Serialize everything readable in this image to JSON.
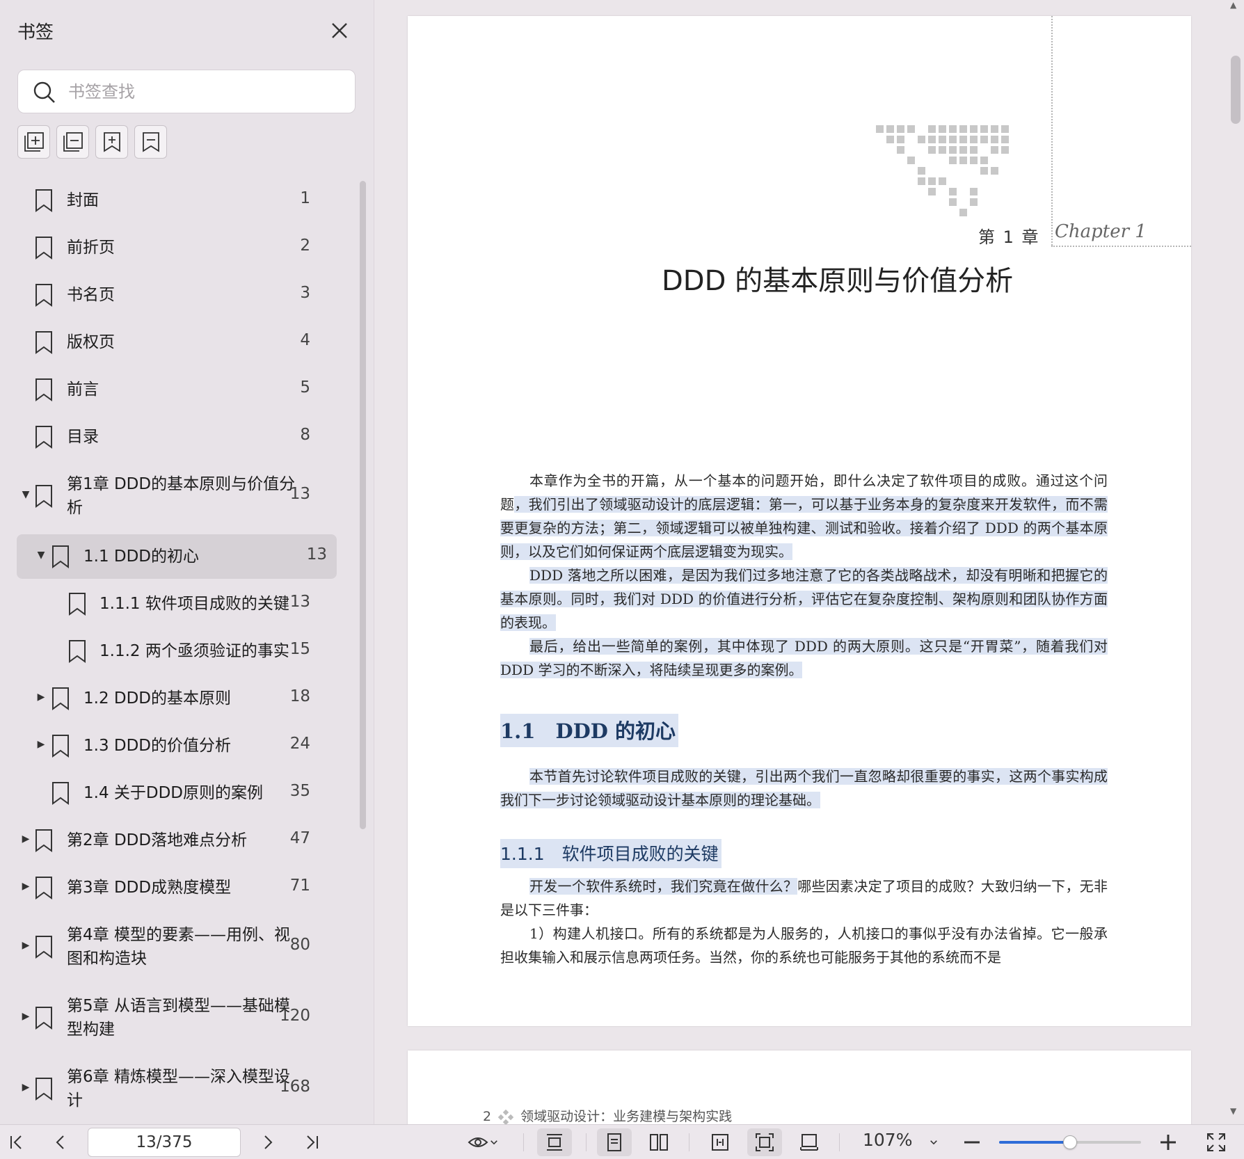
{
  "sidebar": {
    "title": "书签",
    "search": {
      "placeholder": "书签查找",
      "value": ""
    },
    "tools": [
      {
        "name": "expand-all-icon"
      },
      {
        "name": "collapse-all-icon"
      },
      {
        "name": "add-bookmark-icon"
      },
      {
        "name": "bookmark-settings-icon"
      }
    ],
    "items": [
      {
        "label": "封面",
        "page": "1",
        "level": 0,
        "caret": ""
      },
      {
        "label": "前折页",
        "page": "2",
        "level": 0,
        "caret": ""
      },
      {
        "label": "书名页",
        "page": "3",
        "level": 0,
        "caret": ""
      },
      {
        "label": "版权页",
        "page": "4",
        "level": 0,
        "caret": ""
      },
      {
        "label": "前言",
        "page": "5",
        "level": 0,
        "caret": ""
      },
      {
        "label": "目录",
        "page": "8",
        "level": 0,
        "caret": ""
      },
      {
        "label": "第1章 DDD的基本原则与价值分析",
        "page": "13",
        "level": 0,
        "caret": "down"
      },
      {
        "label": "1.1 DDD的初心",
        "page": "13",
        "level": 1,
        "caret": "down",
        "selected": true
      },
      {
        "label": "1.1.1 软件项目成败的关键",
        "page": "13",
        "level": 2,
        "caret": ""
      },
      {
        "label": "1.1.2 两个亟须验证的事实",
        "page": "15",
        "level": 2,
        "caret": ""
      },
      {
        "label": "1.2 DDD的基本原则",
        "page": "18",
        "level": 1,
        "caret": "right"
      },
      {
        "label": "1.3 DDD的价值分析",
        "page": "24",
        "level": 1,
        "caret": "right"
      },
      {
        "label": "1.4 关于DDD原则的案例",
        "page": "35",
        "level": 1,
        "caret": ""
      },
      {
        "label": "第2章 DDD落地难点分析",
        "page": "47",
        "level": 0,
        "caret": "right"
      },
      {
        "label": "第3章 DDD成熟度模型",
        "page": "71",
        "level": 0,
        "caret": "right"
      },
      {
        "label": "第4章 模型的要素——用例、视图和构造块",
        "page": "80",
        "level": 0,
        "caret": "right"
      },
      {
        "label": "第5章 从语言到模型——基础模型构建",
        "page": "120",
        "level": 0,
        "caret": "right"
      },
      {
        "label": "第6章 精炼模型——深入模型设计",
        "page": "168",
        "level": 0,
        "caret": "right"
      }
    ]
  },
  "document": {
    "page1": {
      "chapter_number": "第 1 章",
      "chapter_script": "Chapter 1",
      "chapter_title": "DDD 的基本原则与价值分析",
      "intro_p1_a": "本章作为全书的开篇，从一个基本的问题开始，即什么决定了软件项目的成败。通过这个问题",
      "intro_p1_b": "，我们引出了领域驱动设计的底层逻辑：第一，可以基于业务本身的复杂度来开发软件，而不需要更复杂的方法；第二，领域逻辑可以被单独构建、测试和验收。接着介绍了 DDD 的两个基本原则，以及它们如何保证两个底层逻辑变为现实。",
      "intro_p2": "DDD 落地之所以困难，是因为我们过多地注意了它的各类战略战术，却没有明晰和把握它的基本原则。同时，我们对 DDD 的价值进行分析，评估它在复杂度控制、架构原则和团队协作方面的表现。",
      "intro_p3": "最后，给出一些简单的案例，其中体现了 DDD 的两大原则。这只是“开胃菜”，随着我们对 DDD 学习的不断深入，将陆续呈现更多的案例。",
      "section_1_1": "1.1　DDD 的初心",
      "sec_p1": "本节首先讨论软件项目成败的关键，引出两个我们一直忽略却很重要的事实，这两个事实构成我们下一步讨论领域驱动设计基本原则的理论基础。",
      "section_1_1_1": "1.1.1　软件项目成败的关键",
      "body_p1_a": "开发一个软件系统时，我们究竟在做什么？",
      "body_p1_b": "哪些因素决定了项目的成败？大致归纳一下，无非是以下三件事：",
      "body_p2": "1）构建人机接口。所有的系统都是为人服务的，人机接口的事似乎没有办法省掉。它一般承担收集输入和展示信息两项任务。当然，你的系统也可能服务于其他的系统而不是"
    },
    "page2": {
      "page_number": "2",
      "running_title": "领域驱动设计：业务建模与架构实践"
    }
  },
  "toolbar": {
    "current_page": "13/375",
    "zoom": "107%",
    "zoom_fraction": 0.5,
    "accent": "#2e6cd8"
  }
}
